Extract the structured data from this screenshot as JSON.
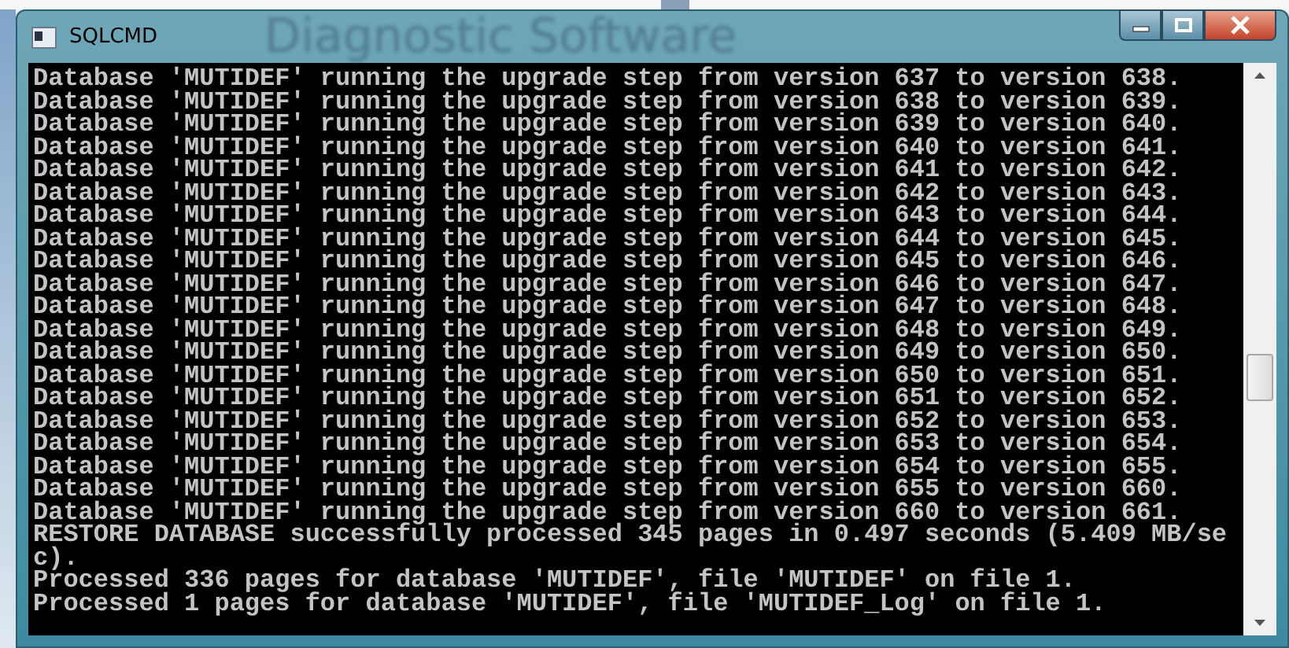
{
  "background_window": {
    "title": "Diagnostic Software"
  },
  "window": {
    "title": "SQLCMD"
  },
  "console_lines": [
    "Database 'MUTIDEF' running the upgrade step from version 637 to version 638.",
    "Database 'MUTIDEF' running the upgrade step from version 638 to version 639.",
    "Database 'MUTIDEF' running the upgrade step from version 639 to version 640.",
    "Database 'MUTIDEF' running the upgrade step from version 640 to version 641.",
    "Database 'MUTIDEF' running the upgrade step from version 641 to version 642.",
    "Database 'MUTIDEF' running the upgrade step from version 642 to version 643.",
    "Database 'MUTIDEF' running the upgrade step from version 643 to version 644.",
    "Database 'MUTIDEF' running the upgrade step from version 644 to version 645.",
    "Database 'MUTIDEF' running the upgrade step from version 645 to version 646.",
    "Database 'MUTIDEF' running the upgrade step from version 646 to version 647.",
    "Database 'MUTIDEF' running the upgrade step from version 647 to version 648.",
    "Database 'MUTIDEF' running the upgrade step from version 648 to version 649.",
    "Database 'MUTIDEF' running the upgrade step from version 649 to version 650.",
    "Database 'MUTIDEF' running the upgrade step from version 650 to version 651.",
    "Database 'MUTIDEF' running the upgrade step from version 651 to version 652.",
    "Database 'MUTIDEF' running the upgrade step from version 652 to version 653.",
    "Database 'MUTIDEF' running the upgrade step from version 653 to version 654.",
    "Database 'MUTIDEF' running the upgrade step from version 654 to version 655.",
    "Database 'MUTIDEF' running the upgrade step from version 655 to version 660.",
    "Database 'MUTIDEF' running the upgrade step from version 660 to version 661.",
    "RESTORE DATABASE successfully processed 345 pages in 0.497 seconds (5.409 MB/sec).",
    "Processed 336 pages for database 'MUTIDEF', file 'MUTIDEF' on file 1.",
    "Processed 1 pages for database 'MUTIDEF', file 'MUTIDEF_Log' on file 1."
  ]
}
